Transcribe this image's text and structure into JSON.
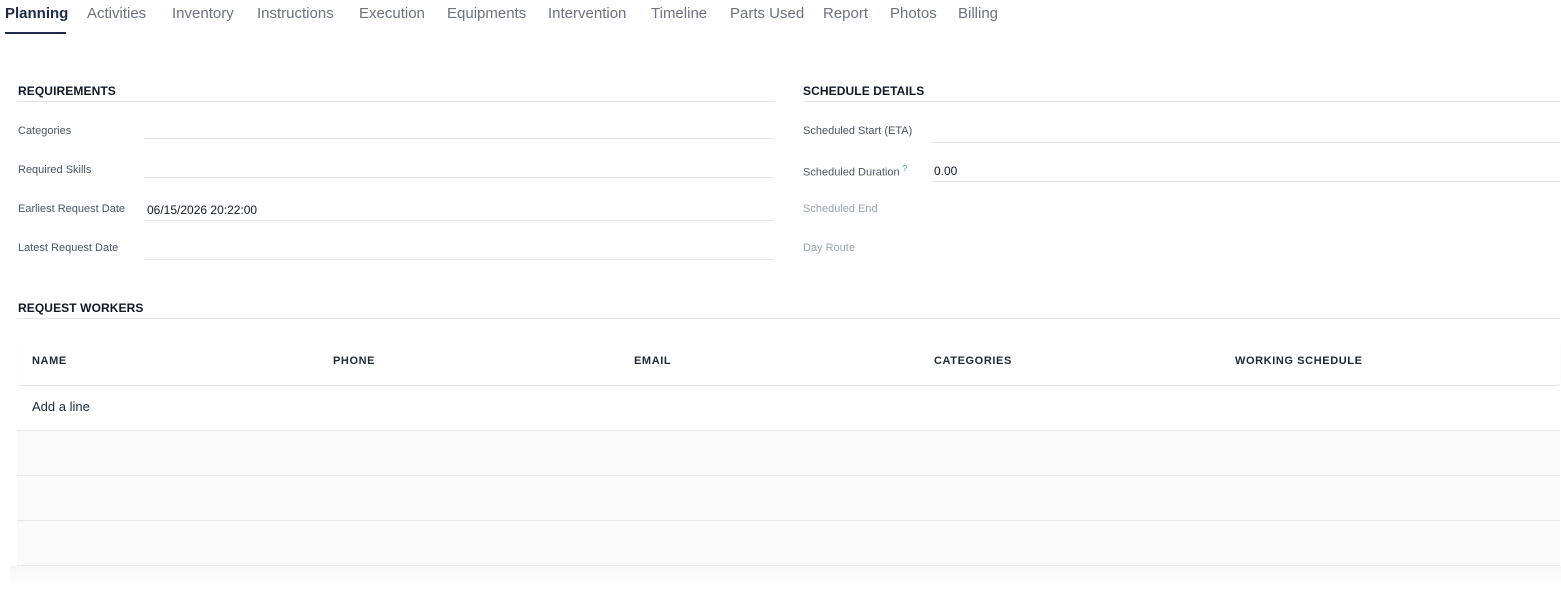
{
  "tabs": [
    {
      "label": "Planning",
      "active": true
    },
    {
      "label": "Activities"
    },
    {
      "label": "Inventory"
    },
    {
      "label": "Instructions"
    },
    {
      "label": "Execution"
    },
    {
      "label": "Equipments"
    },
    {
      "label": "Intervention"
    },
    {
      "label": "Timeline"
    },
    {
      "label": "Parts Used"
    },
    {
      "label": "Report"
    },
    {
      "label": "Photos"
    },
    {
      "label": "Billing"
    }
  ],
  "requirements": {
    "title": "REQUIREMENTS",
    "fields": [
      {
        "label": "Categories",
        "value": ""
      },
      {
        "label": "Required Skills",
        "value": ""
      },
      {
        "label": "Earliest Request Date",
        "value": "06/15/2026 20:22:00"
      },
      {
        "label": "Latest Request Date",
        "value": ""
      }
    ]
  },
  "schedule": {
    "title": "SCHEDULE DETAILS",
    "fields": [
      {
        "label": "Scheduled Start (ETA)",
        "value": ""
      },
      {
        "label": "Scheduled Duration",
        "help": "?",
        "value": "0.00"
      },
      {
        "label": "Scheduled End",
        "value": ""
      },
      {
        "label": "Day Route",
        "value": ""
      }
    ]
  },
  "workers": {
    "title": "REQUEST WORKERS",
    "columns": [
      "NAME",
      "PHONE",
      "EMAIL",
      "CATEGORIES",
      "WORKING SCHEDULE"
    ],
    "add_line": "Add a line"
  },
  "colors": {
    "accent": "#1e2a4a",
    "help_mark": "#0ea5b7"
  }
}
